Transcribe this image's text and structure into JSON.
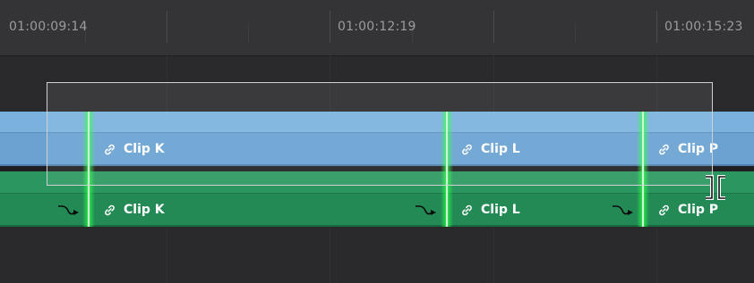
{
  "ruler": {
    "timecodes": [
      "01:00:09:14",
      "01:00:12:19",
      "01:00:15:23"
    ]
  },
  "tracks": {
    "video": {
      "clips": [
        {
          "label": "Clip K"
        },
        {
          "label": "Clip L"
        },
        {
          "label": "Clip P"
        }
      ]
    },
    "audio": {
      "clips": [
        {
          "label": "Clip K"
        },
        {
          "label": "Clip L"
        },
        {
          "label": "Clip P"
        }
      ]
    }
  },
  "colors": {
    "video_clip": "#6aa2d2",
    "audio_clip": "#238a56",
    "edit_point_highlight": "#39ff4a",
    "background": "#28282a"
  },
  "icons": {
    "clip_link": "link-icon",
    "audio_fade": "audio-fade-icon",
    "cursor": "trim-cursor-icon"
  }
}
